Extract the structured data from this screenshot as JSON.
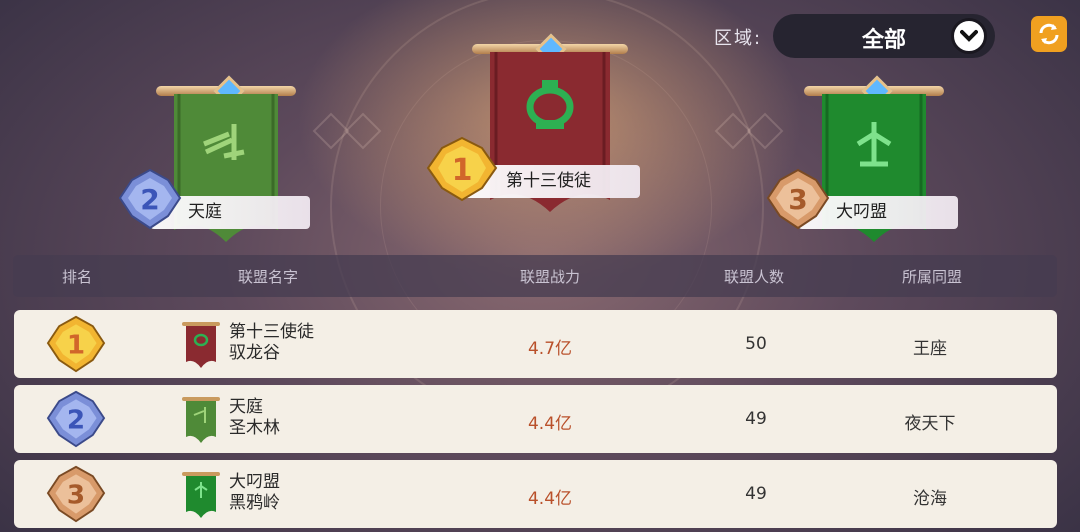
{
  "region": {
    "label": "区域:",
    "value": "全部"
  },
  "podium": [
    {
      "rank": "1",
      "name": "第十三使徒",
      "flag_color": "#8a2a30",
      "emblem_color": "#2db052"
    },
    {
      "rank": "2",
      "name": "天庭",
      "flag_color": "#4f8a38",
      "emblem_color": "#9fd47a"
    },
    {
      "rank": "3",
      "name": "大叼盟",
      "flag_color": "#1f8a2e",
      "emblem_color": "#7ee28c"
    }
  ],
  "table": {
    "headers": {
      "rank": "排名",
      "name": "联盟名字",
      "power": "联盟战力",
      "members": "联盟人数",
      "parent": "所属同盟"
    },
    "rows": [
      {
        "rank": "1",
        "name": "第十三使徒",
        "server": "驭龙谷",
        "power": "4.7亿",
        "members": "50",
        "parent": "王座"
      },
      {
        "rank": "2",
        "name": "天庭",
        "server": "圣木林",
        "power": "4.4亿",
        "members": "49",
        "parent": "夜天下"
      },
      {
        "rank": "3",
        "name": "大叼盟",
        "server": "黑鸦岭",
        "power": "4.4亿",
        "members": "49",
        "parent": "沧海"
      }
    ]
  },
  "colors": {
    "gold": "#f2b531",
    "silver": "#7b8fd8",
    "bronze": "#d89a6a",
    "accent_orange": "#f0a020"
  }
}
